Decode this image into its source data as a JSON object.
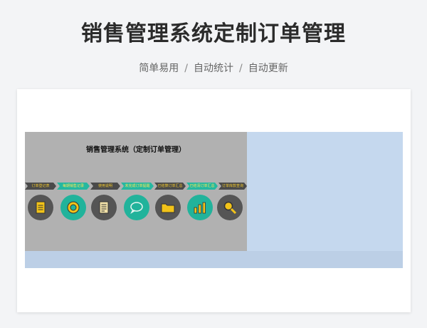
{
  "header": {
    "title": "销售管理系统定制订单管理",
    "features": [
      "简单易用",
      "自动统计",
      "自动更新"
    ],
    "separator": "/"
  },
  "panel": {
    "title": "销售管理系统（定制订单管理）",
    "nav_tabs": [
      {
        "label": "订单登记表",
        "style": "dark",
        "icon": "document-icon"
      },
      {
        "label": "每期销售记录",
        "style": "teal",
        "icon": "coin-icon"
      },
      {
        "label": "使用说明",
        "style": "dark",
        "icon": "notes-icon"
      },
      {
        "label": "未完成订单提醒",
        "style": "teal",
        "icon": "chat-icon"
      },
      {
        "label": "已结算订单汇总",
        "style": "dark",
        "icon": "folder-icon"
      },
      {
        "label": "已结清订单汇总",
        "style": "teal",
        "icon": "bar-chart-icon"
      },
      {
        "label": "订单库款查询",
        "style": "dark",
        "icon": "search-icon"
      }
    ]
  },
  "colors": {
    "panel_bg": "#b1b1b1",
    "sheet_bg": "#c5d8ee",
    "teal": "#21b39b",
    "dark": "#555555",
    "icon_yellow": "#f2c319"
  }
}
